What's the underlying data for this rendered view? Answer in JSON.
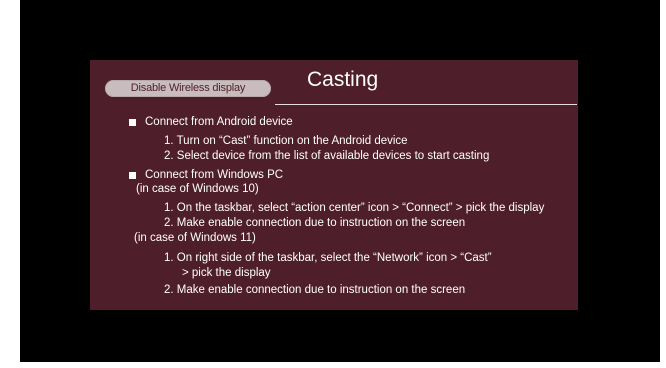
{
  "slide": {
    "button_label": "Disable Wireless display",
    "title": "Casting",
    "sections": [
      {
        "heading": "Connect from Android device",
        "items": [
          "1.  Turn on “Cast” function on the Android device",
          "2.  Select device from the list of available devices to start casting"
        ]
      },
      {
        "heading": "Connect from Windows PC",
        "win10_note": "(in case of Windows 10)",
        "win10_items": [
          "1.  On the taskbar, select “action center” icon > “Connect” > pick the display",
          "2.  Make enable connection due to instruction on the screen"
        ],
        "win11_note": "(in case of Windows 11)",
        "win11_items": [
          "1.  On right side of the taskbar, select the “Network” icon > “Cast”",
          "> pick the display",
          "2.  Make enable connection due to instruction on the screen"
        ]
      }
    ]
  },
  "colors": {
    "display_bg": "#000000",
    "slide_bg": "#4e1e2a",
    "button_bg": "#c8bcbe",
    "text": "#ffffff"
  }
}
